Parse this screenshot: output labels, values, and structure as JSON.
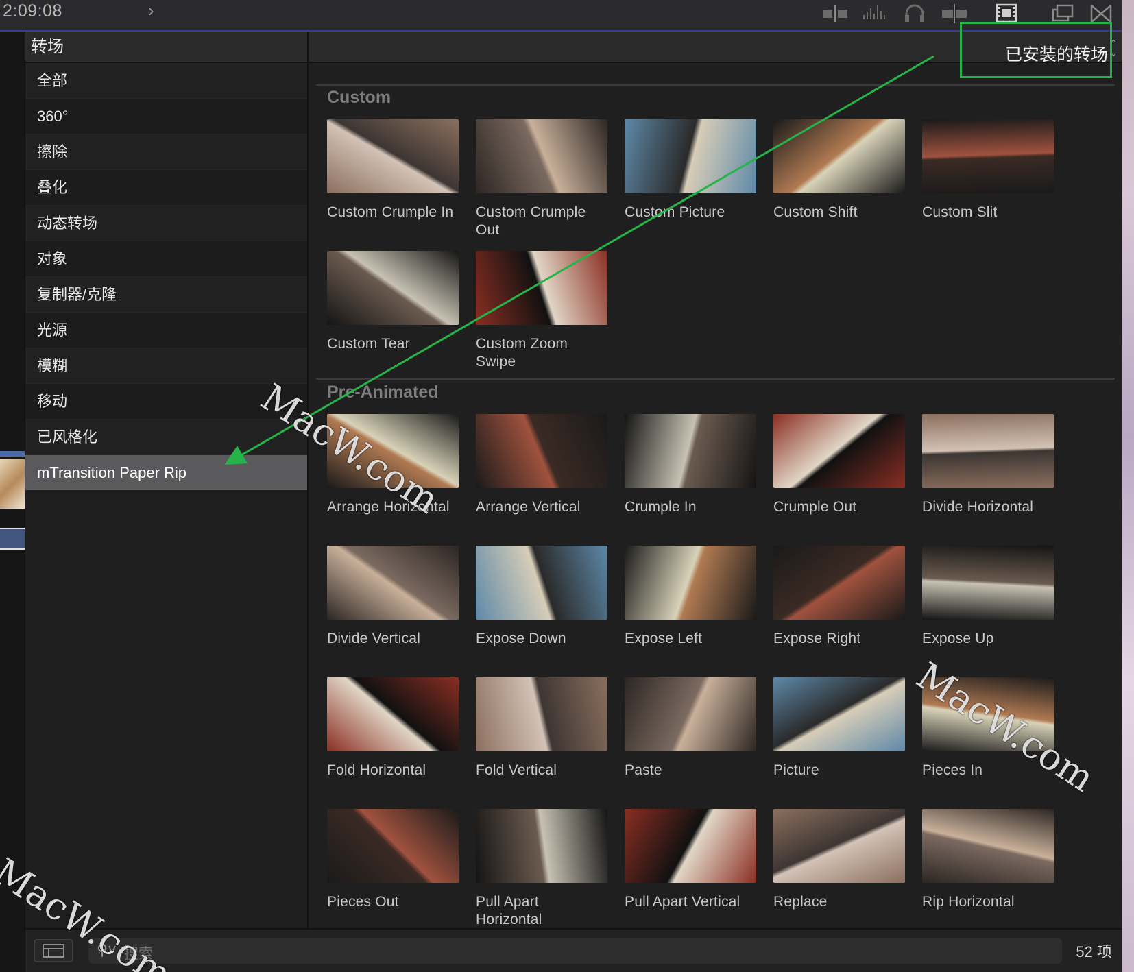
{
  "topbar": {
    "timecode": "2:09:08"
  },
  "sidebar": {
    "header": "转场",
    "categories": [
      "全部",
      "360°",
      "擦除",
      "叠化",
      "动态转场",
      "对象",
      "复制器/克隆",
      "光源",
      "模糊",
      "移动",
      "已风格化",
      "mTransition Paper Rip"
    ],
    "selected_index": 11
  },
  "main": {
    "filter_label": "已安装的转场",
    "sections": [
      {
        "title": "Custom",
        "items": [
          "Custom Crumple In",
          "Custom Crumple Out",
          "Custom Picture",
          "Custom Shift",
          "Custom Slit",
          "Custom Tear",
          "Custom Zoom Swipe"
        ]
      },
      {
        "title": "Pre-Animated",
        "items": [
          "Arrange Horizontal",
          "Arrange Vertical",
          "Crumple In",
          "Crumple Out",
          "Divide Horizontal",
          "Divide Vertical",
          "Expose Down",
          "Expose Left",
          "Expose Right",
          "Expose Up",
          "Fold Horizontal",
          "Fold Vertical",
          "Paste",
          "Picture",
          "Pieces In",
          "Pieces Out",
          "Pull Apart Horizontal",
          "Pull Apart Vertical",
          "Replace",
          "Rip Horizontal"
        ]
      }
    ]
  },
  "bottom": {
    "search_placeholder": "搜索",
    "count": "52 项"
  },
  "watermark": "MacW.com",
  "colors": {
    "highlight": "#26b34a",
    "selection": "#5a5a5c",
    "accent_line": "#3a3c8a"
  }
}
